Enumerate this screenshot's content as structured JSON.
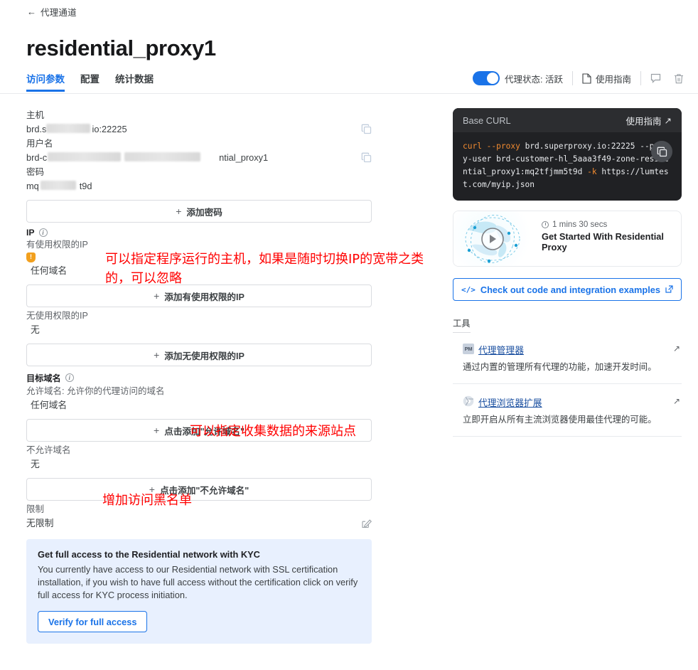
{
  "breadcrumb": {
    "arrow": "←",
    "label": "代理通道"
  },
  "page": {
    "title": "residential_proxy1"
  },
  "tabs": [
    {
      "label": "访问参数",
      "active": true
    },
    {
      "label": "配置",
      "active": false
    },
    {
      "label": "统计数据",
      "active": false
    }
  ],
  "header_controls": {
    "status_label": "代理状态: 活跃",
    "toggle_on": true,
    "guide_label": "使用指南",
    "icons": [
      "file-icon",
      "chat-icon",
      "trash-icon"
    ]
  },
  "credentials": {
    "host_label": "主机",
    "host_value_prefix": "brd.s",
    "host_value_suffix": "io:22225",
    "username_label": "用户名",
    "username_value_prefix": "brd-c",
    "username_value_suffix": "ntial_proxy1",
    "password_label": "密码",
    "password_value_prefix": "mq",
    "password_value_suffix": "t9d",
    "add_password_button": "添加密码",
    "copy_icon": "copy-icon"
  },
  "ip_section": {
    "heading": "IP",
    "allowed_label": "有使用权限的IP",
    "allowed_value": "任何域名",
    "add_allowed_button": "添加有使用权限的IP",
    "denied_label": "无使用权限的IP",
    "denied_value": "无",
    "add_denied_button": "添加无使用权限的IP"
  },
  "domain_section": {
    "heading": "目标域名",
    "allowed_label": "允许域名: 允许你的代理访问的域名",
    "allowed_value": "任何域名",
    "add_allowed_button": "点击添加\"允许域名\"",
    "denied_label": "不允许域名",
    "denied_value": "无",
    "add_denied_button": "点击添加\"不允许域名\""
  },
  "limit_section": {
    "label": "限制",
    "value": "无限制",
    "edit_icon": "edit-pencil-icon"
  },
  "annotations": [
    {
      "id": "annot-ip",
      "text": "可以指定程序运行的主机，如果是随时切换IP的宽带之类的，可以忽略",
      "color": "#ff0000"
    },
    {
      "id": "annot-domain",
      "text": "可以指定收集数据的来源站点",
      "color": "#ff0000"
    },
    {
      "id": "annot-blacklist",
      "text": "增加访问黑名单",
      "color": "#ff0000"
    }
  ],
  "kyc_banner": {
    "title": "Get full access to the Residential network with KYC",
    "body": "You currently have access to our Residential network with SSL certification installation, if you wish to have full access without the certification click on verify full access for KYC process initiation.",
    "button": "Verify for full access",
    "bg_color": "#e8f0fe"
  },
  "curl_card": {
    "title": "Base CURL",
    "guide_label": "使用指南",
    "copy_icon": "copy-icon",
    "code_part1": "curl --proxy",
    "code_part2": " brd.superproxy.io:22225 --proxy-user brd-customer-hl_5aaa3f49-zone-residential_proxy1:mq2tfjmm5t9d ",
    "code_part3": "-k",
    "code_part4": " https://lumtest.com/myip.json"
  },
  "video_card": {
    "duration": "1 mins 30 secs",
    "title": "Get Started With Residential Proxy",
    "play_icon": "play-icon",
    "thumb_icon": "globe-network-icon"
  },
  "code_examples_link": {
    "label": "Check out code and integration examples",
    "icon": "code-brackets-icon",
    "external_icon": "external-link-icon"
  },
  "tools": {
    "heading": "工具",
    "items": [
      {
        "icon": "proxy-manager-icon",
        "name": "代理管理器",
        "desc": "通过内置的管理所有代理的功能，加速开发时间。",
        "external_icon": "arrow-up-right-icon"
      },
      {
        "icon": "browser-extension-icon",
        "name": "代理浏览器扩展",
        "desc": "立即开启从所有主流浏览器使用最佳代理的可能。",
        "external_icon": "arrow-up-right-icon"
      }
    ]
  },
  "theme": {
    "accent": "#1a73e8",
    "warning": "#f2a01e",
    "annotation": "#ff0000",
    "code_keyword": "#f28b30"
  }
}
